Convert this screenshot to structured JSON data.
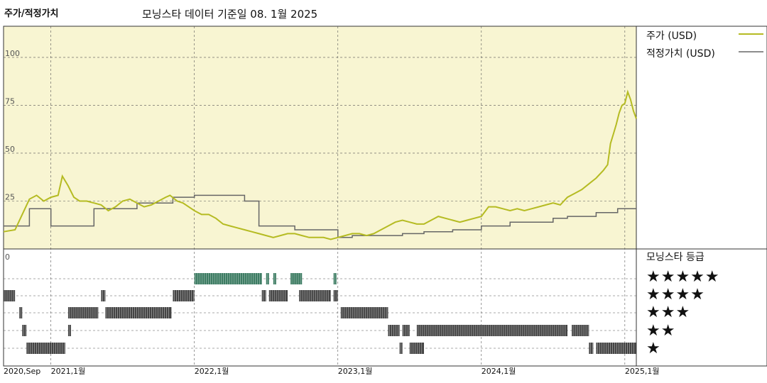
{
  "header": {
    "left_title": "주가/적정가치",
    "subtitle": "모닝스타 데이터 기준일 08. 1월 2025"
  },
  "legend": {
    "price_label": "주가 (USD)",
    "fair_label": "적정가치 (USD)",
    "rating_title": "모닝스타 등급"
  },
  "colors": {
    "panel_bg": "#f8f5d2",
    "price_line": "#b5bb22",
    "fair_line": "#666666",
    "five_star_bar": "#3a7a60",
    "bar": "#444444"
  },
  "chart_data": [
    {
      "type": "line",
      "ylim": [
        0,
        100
      ],
      "yticks": [
        "100",
        "75",
        "50",
        "25"
      ],
      "xlim": [
        "2020-09",
        "2025-01"
      ],
      "xtick_labels": [
        "2020,Sep",
        "2021,1월",
        "2022,1월",
        "2023,1월",
        "2024,1월",
        "2025,1월"
      ],
      "xtick_dates": [
        2020.67,
        2021.0,
        2022.0,
        2023.0,
        2024.0,
        2025.0
      ],
      "grid": true,
      "series": [
        {
          "name": "주가 (USD)",
          "points": [
            [
              2020.67,
              9
            ],
            [
              2020.75,
              10
            ],
            [
              2020.8,
              18
            ],
            [
              2020.85,
              26
            ],
            [
              2020.9,
              28
            ],
            [
              2020.95,
              25
            ],
            [
              2021.0,
              27
            ],
            [
              2021.05,
              28
            ],
            [
              2021.08,
              38
            ],
            [
              2021.12,
              33
            ],
            [
              2021.16,
              27
            ],
            [
              2021.2,
              25
            ],
            [
              2021.25,
              25
            ],
            [
              2021.3,
              24
            ],
            [
              2021.35,
              23
            ],
            [
              2021.4,
              20
            ],
            [
              2021.45,
              22
            ],
            [
              2021.5,
              25
            ],
            [
              2021.55,
              26
            ],
            [
              2021.6,
              24
            ],
            [
              2021.65,
              22
            ],
            [
              2021.7,
              23
            ],
            [
              2021.75,
              25
            ],
            [
              2021.8,
              27
            ],
            [
              2021.83,
              28
            ],
            [
              2021.88,
              25
            ],
            [
              2021.92,
              24
            ],
            [
              2021.96,
              22
            ],
            [
              2022.0,
              20
            ],
            [
              2022.05,
              18
            ],
            [
              2022.1,
              18
            ],
            [
              2022.15,
              16
            ],
            [
              2022.2,
              13
            ],
            [
              2022.25,
              12
            ],
            [
              2022.3,
              11
            ],
            [
              2022.35,
              10
            ],
            [
              2022.4,
              9
            ],
            [
              2022.45,
              8
            ],
            [
              2022.5,
              7
            ],
            [
              2022.55,
              6
            ],
            [
              2022.6,
              7
            ],
            [
              2022.65,
              8
            ],
            [
              2022.7,
              8
            ],
            [
              2022.75,
              7
            ],
            [
              2022.8,
              6
            ],
            [
              2022.85,
              6
            ],
            [
              2022.9,
              6
            ],
            [
              2022.95,
              5
            ],
            [
              2023.0,
              6
            ],
            [
              2023.05,
              7
            ],
            [
              2023.1,
              8
            ],
            [
              2023.15,
              8
            ],
            [
              2023.2,
              7
            ],
            [
              2023.25,
              8
            ],
            [
              2023.3,
              10
            ],
            [
              2023.35,
              12
            ],
            [
              2023.4,
              14
            ],
            [
              2023.45,
              15
            ],
            [
              2023.5,
              14
            ],
            [
              2023.55,
              13
            ],
            [
              2023.6,
              13
            ],
            [
              2023.65,
              15
            ],
            [
              2023.7,
              17
            ],
            [
              2023.75,
              16
            ],
            [
              2023.8,
              15
            ],
            [
              2023.85,
              14
            ],
            [
              2023.9,
              15
            ],
            [
              2023.95,
              16
            ],
            [
              2024.0,
              17
            ],
            [
              2024.05,
              22
            ],
            [
              2024.1,
              22
            ],
            [
              2024.15,
              21
            ],
            [
              2024.2,
              20
            ],
            [
              2024.25,
              21
            ],
            [
              2024.3,
              20
            ],
            [
              2024.35,
              21
            ],
            [
              2024.4,
              22
            ],
            [
              2024.45,
              23
            ],
            [
              2024.5,
              24
            ],
            [
              2024.55,
              23
            ],
            [
              2024.6,
              27
            ],
            [
              2024.65,
              29
            ],
            [
              2024.7,
              31
            ],
            [
              2024.75,
              34
            ],
            [
              2024.8,
              37
            ],
            [
              2024.85,
              41
            ],
            [
              2024.88,
              44
            ],
            [
              2024.9,
              55
            ],
            [
              2024.92,
              60
            ],
            [
              2024.94,
              65
            ],
            [
              2024.96,
              71
            ],
            [
              2024.98,
              75
            ],
            [
              2025.0,
              76
            ],
            [
              2025.02,
              82
            ],
            [
              2025.04,
              78
            ],
            [
              2025.06,
              72
            ],
            [
              2025.08,
              68
            ]
          ]
        },
        {
          "name": "적정가치 (USD)",
          "points": [
            [
              2020.67,
              12
            ],
            [
              2020.85,
              12
            ],
            [
              2020.85,
              21
            ],
            [
              2021.0,
              21
            ],
            [
              2021.0,
              12
            ],
            [
              2021.3,
              12
            ],
            [
              2021.3,
              21
            ],
            [
              2021.6,
              21
            ],
            [
              2021.6,
              24
            ],
            [
              2021.85,
              24
            ],
            [
              2021.85,
              27
            ],
            [
              2022.0,
              27
            ],
            [
              2022.0,
              28
            ],
            [
              2022.35,
              28
            ],
            [
              2022.35,
              25
            ],
            [
              2022.45,
              25
            ],
            [
              2022.45,
              12
            ],
            [
              2022.7,
              12
            ],
            [
              2022.7,
              10
            ],
            [
              2023.0,
              10
            ],
            [
              2023.0,
              6
            ],
            [
              2023.1,
              6
            ],
            [
              2023.1,
              7
            ],
            [
              2023.45,
              7
            ],
            [
              2023.45,
              8
            ],
            [
              2023.6,
              8
            ],
            [
              2023.6,
              9
            ],
            [
              2023.8,
              9
            ],
            [
              2023.8,
              10
            ],
            [
              2024.0,
              10
            ],
            [
              2024.0,
              12
            ],
            [
              2024.2,
              12
            ],
            [
              2024.2,
              14
            ],
            [
              2024.5,
              14
            ],
            [
              2024.5,
              16
            ],
            [
              2024.6,
              16
            ],
            [
              2024.6,
              17
            ],
            [
              2024.8,
              17
            ],
            [
              2024.8,
              19
            ],
            [
              2024.95,
              19
            ],
            [
              2024.95,
              21
            ],
            [
              2025.08,
              21
            ]
          ]
        }
      ]
    },
    {
      "type": "table",
      "title": "모닝스타 등급",
      "xlim": [
        "2020-09",
        "2025-01"
      ],
      "rows": [
        {
          "label": "★★★★★",
          "segments": [
            [
              2022.0,
              2022.47
            ],
            [
              2022.5,
              2022.52
            ],
            [
              2022.55,
              2022.57
            ],
            [
              2022.67,
              2022.75
            ],
            [
              2022.97,
              2022.99
            ]
          ]
        },
        {
          "label": "★★★★",
          "segments": [
            [
              2020.67,
              2020.75
            ],
            [
              2021.35,
              2021.38
            ],
            [
              2021.85,
              2022.0
            ],
            [
              2022.47,
              2022.5
            ],
            [
              2022.52,
              2022.65
            ],
            [
              2022.73,
              2022.95
            ],
            [
              2022.97,
              2023.0
            ]
          ]
        },
        {
          "label": "★★★",
          "segments": [
            [
              2020.78,
              2020.8
            ],
            [
              2021.12,
              2021.33
            ],
            [
              2021.38,
              2021.84
            ],
            [
              2023.02,
              2023.35
            ]
          ]
        },
        {
          "label": "★★",
          "segments": [
            [
              2020.8,
              2020.83
            ],
            [
              2021.12,
              2021.14
            ],
            [
              2023.35,
              2023.43
            ],
            [
              2023.45,
              2023.5
            ],
            [
              2023.55,
              2024.6
            ],
            [
              2024.63,
              2024.75
            ]
          ]
        },
        {
          "label": "★",
          "segments": [
            [
              2020.83,
              2021.1
            ],
            [
              2023.43,
              2023.45
            ],
            [
              2023.5,
              2023.6
            ],
            [
              2024.75,
              2024.78
            ],
            [
              2024.8,
              2025.08
            ]
          ]
        }
      ]
    }
  ]
}
